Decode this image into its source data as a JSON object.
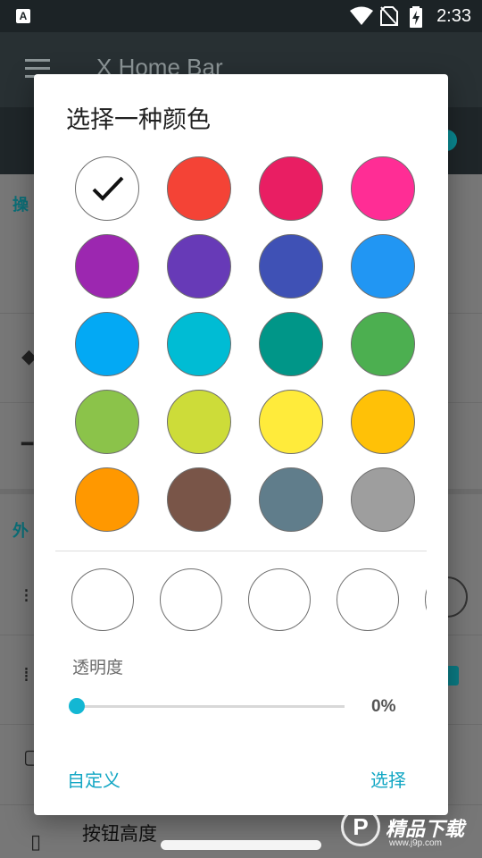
{
  "status_bar": {
    "time": "2:33",
    "app_badge": "A"
  },
  "app_bar": {
    "title": "X Home Bar"
  },
  "background": {
    "section1_fragment": "操",
    "section2_fragment": "外",
    "bottom_item_label": "按钮高度"
  },
  "dialog": {
    "title": "选择一种颜色",
    "swatches": [
      {
        "color": "#ffffff",
        "selected": true
      },
      {
        "color": "#f44336"
      },
      {
        "color": "#e91e63"
      },
      {
        "color": "#ff2d95"
      },
      {
        "color": "#9c27b0"
      },
      {
        "color": "#673ab7"
      },
      {
        "color": "#3f51b5"
      },
      {
        "color": "#2196f3"
      },
      {
        "color": "#03a9f4"
      },
      {
        "color": "#00bcd4"
      },
      {
        "color": "#009688"
      },
      {
        "color": "#4caf50"
      },
      {
        "color": "#8bc34a"
      },
      {
        "color": "#cddc39"
      },
      {
        "color": "#ffeb3b"
      },
      {
        "color": "#ffc107"
      },
      {
        "color": "#ff9800"
      },
      {
        "color": "#795548"
      },
      {
        "color": "#607d8b"
      },
      {
        "color": "#9e9e9e"
      }
    ],
    "recent_colors": [
      "#ffffff",
      "#ffffff",
      "#ffffff",
      "#ffffff",
      "#ffffff"
    ],
    "opacity_label": "透明度",
    "opacity_value": "0%",
    "opacity_fraction": 0,
    "custom_button": "自定义",
    "select_button": "选择"
  },
  "watermark": {
    "text": "精品下载",
    "url": "www.j9p.com",
    "logo_letter": "P"
  }
}
